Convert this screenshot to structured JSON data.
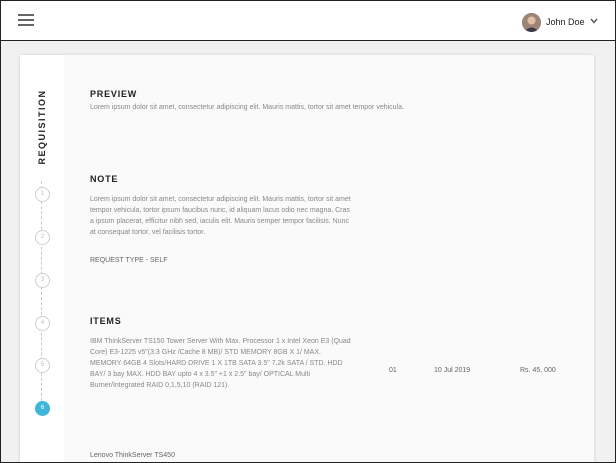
{
  "header": {
    "user_name": "John Doe"
  },
  "stepper": {
    "title": "REQUISITION",
    "steps": [
      "1",
      "2",
      "3",
      "4",
      "5",
      "6"
    ],
    "active_step": "6",
    "accent_color": "#3fb5d8"
  },
  "preview": {
    "title": "PREVIEW",
    "text": "Lorem ipsum dolor sit amet, consectetur adipiscing elit. Mauris mattis, tortor sit amet tempor vehicula."
  },
  "note": {
    "title": "NOTE",
    "text": "Lorem ipsum dolor sit amet, consectetur adipiscing elit. Mauris mattis, tortor sit amet tempor vehicula, tortor ipsum faucibus nunc, id aliquam lacus odio nec magna. Cras a ipsum placerat, efficitur nibh sed, iaculis elit. Mauris semper tempor facilisis. Nunc at consequat tortor, vel facilisis tortor.",
    "request_type": "REQUEST TYPE  - SELF"
  },
  "items": {
    "title": "ITEMS",
    "rows": [
      {
        "description": "IBM ThinkServer TS150 Tower Server With Max. Processor 1 x Intel Xeon E3 (Quad Core) E3-1225 v5\"(3.3 GHz /Cache 8 MB)/ STD MEMORY 8GB X 1/ MAX. MEMORY 64GB 4 Slots/HARD DRIVE 1 X 1TB SATA 3.5\" 7.2k SATA / STD. HDD BAY/ 3 bay MAX. HDD BAY upto 4 x 3.5\" +1 x 2.5\" bay/ OPTICAL Multi Burner/Integrated RAID 0,1,5,10 (RAID 121).",
        "quantity": "01",
        "date": "10 Jul 2019",
        "price": "Rs. 45, 000"
      },
      {
        "description": "Lenovo ThinkServer TS450"
      }
    ]
  }
}
